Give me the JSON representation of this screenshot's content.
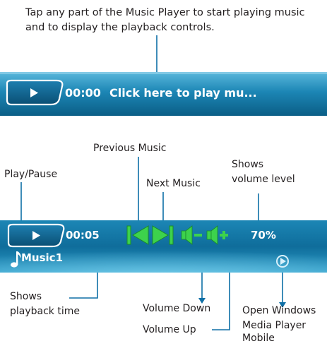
{
  "instructions": "Tap any part of the Music Player to start playing music and to display the playback controls.",
  "collapsed_player": {
    "time": "00:00",
    "status": "Click here to play mu..."
  },
  "expanded_player": {
    "time": "00:05",
    "volume": "70%",
    "track": "Music1"
  },
  "callouts": {
    "play_pause": "Play/Pause",
    "previous_music": "Previous Music",
    "next_music": "Next Music",
    "volume_level_1": "Shows",
    "volume_level_2": "volume level",
    "playback_time_1": "Shows",
    "playback_time_2": "playback time",
    "volume_down": "Volume Down",
    "volume_up": "Volume Up",
    "wmp_1": "Open Windows",
    "wmp_2": "Media Player",
    "wmp_3": "Mobile"
  },
  "colors": {
    "bar_dark": "#0b5e86",
    "bar_light": "#2c9bc7",
    "control_green": "#3dd24c",
    "callout_line": "#0e6fa6"
  },
  "icons": [
    "play-icon",
    "previous-track-icon",
    "next-track-icon",
    "volume-down-icon",
    "volume-up-icon",
    "music-note-icon",
    "windows-media-player-icon"
  ]
}
